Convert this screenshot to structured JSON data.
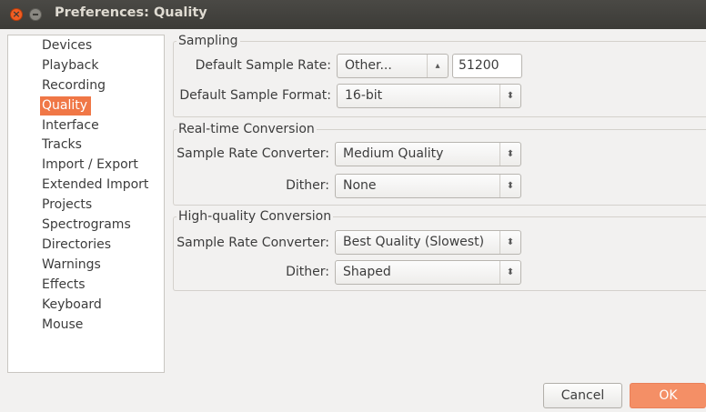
{
  "window": {
    "title": "Preferences: Quality"
  },
  "sidebar": {
    "items": [
      {
        "label": "Devices"
      },
      {
        "label": "Playback"
      },
      {
        "label": "Recording"
      },
      {
        "label": "Quality"
      },
      {
        "label": "Interface"
      },
      {
        "label": "Tracks"
      },
      {
        "label": "Import / Export"
      },
      {
        "label": "Extended Import"
      },
      {
        "label": "Projects"
      },
      {
        "label": "Spectrograms"
      },
      {
        "label": "Directories"
      },
      {
        "label": "Warnings"
      },
      {
        "label": "Effects"
      },
      {
        "label": "Keyboard"
      },
      {
        "label": "Mouse"
      }
    ],
    "selected": "Quality"
  },
  "sampling": {
    "title": "Sampling",
    "rate_label": "Default Sample Rate:",
    "rate_value": "Other...",
    "rate_entry": "51200",
    "format_label": "Default Sample Format:",
    "format_value": "16-bit"
  },
  "realtime": {
    "title": "Real-time Conversion",
    "converter_label": "Sample Rate Converter:",
    "converter_value": "Medium Quality",
    "dither_label": "Dither:",
    "dither_value": "None"
  },
  "highquality": {
    "title": "High-quality Conversion",
    "converter_label": "Sample Rate Converter:",
    "converter_value": "Best Quality (Slowest)",
    "dither_label": "Dither:",
    "dither_value": "Shaped"
  },
  "buttons": {
    "cancel": "Cancel",
    "ok": "OK"
  },
  "icons": {
    "close": "close-icon",
    "minimize": "minimize-icon",
    "spin": "spin-arrows-icon"
  },
  "colors": {
    "accent": "#f07746",
    "titlebar": "#3c3b37"
  }
}
